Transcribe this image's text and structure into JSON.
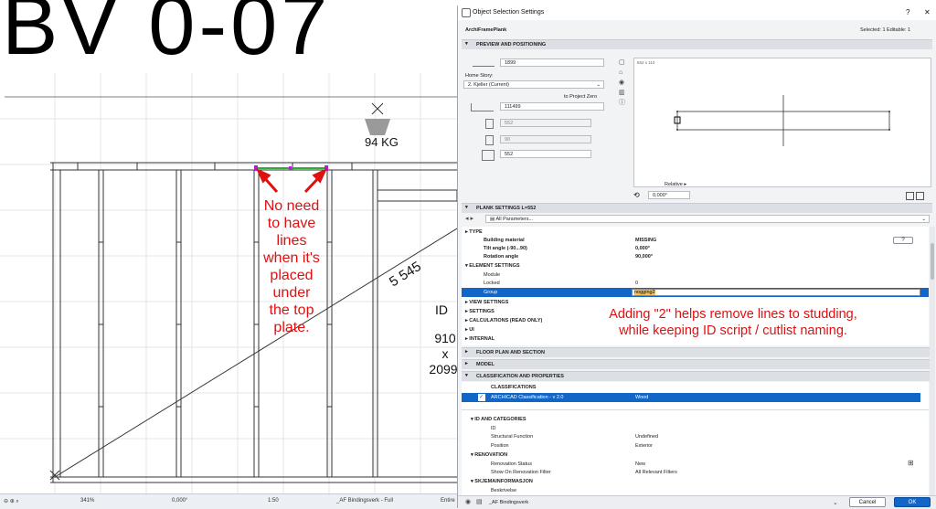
{
  "canvas": {
    "title_text": "BV 0-07",
    "weight_label": "94 KG",
    "dimension_label": "5 545",
    "id_label": "ID",
    "id_value_1": "910",
    "id_value_2": "x",
    "id_value_3": "2099",
    "annotation_left_lines": [
      "No need",
      "to have",
      "lines",
      "when it's",
      "placed",
      "under",
      "the top",
      "plate."
    ],
    "annotation_right_line1": "Adding \"2\" helps remove lines to studding,",
    "annotation_right_line2": "while keeping ID script / cutlist naming."
  },
  "statusbar": {
    "zoom": "341%",
    "angle": "0,000°",
    "scale": "1:50",
    "layer_set": "_AF Bindingsverk - Full",
    "entire": "Entire"
  },
  "dialog": {
    "title": "Object Selection Settings",
    "help": "?",
    "close": "✕",
    "object_name": "ArchiFramePlank",
    "selected_info": "Selected: 1 Editable: 1",
    "preview_section": "PREVIEW AND POSITIONING",
    "field_top": "1899",
    "home_story_label": "Home Story:",
    "home_story_value": "2. Kjeller (Current)",
    "to_project_zero": "to Project Zero",
    "elevation": "111499",
    "dim_a": "552",
    "dim_b": "90",
    "dim_c": "552",
    "preview_size": "552 x 110",
    "relative_label": "Relative",
    "angle_value": "0,000°",
    "plank_section": "PLANK SETTINGS L=552",
    "all_parameters": "All Parameters...",
    "type_heading": "TYPE",
    "params": [
      {
        "name": "Building material",
        "value": "MISSING"
      },
      {
        "name": "Tilt angle (-90...90)",
        "value": "0,000°"
      },
      {
        "name": "Rotation angle",
        "value": "90,000°"
      }
    ],
    "element_settings": "ELEMENT SETTINGS",
    "module_label": "Module",
    "locked_label": "Locked",
    "locked_value": "0",
    "group_label": "Group",
    "group_value": "nogging2",
    "view_settings": "VIEW SETTINGS",
    "settings": "SETTINGS",
    "calculations": "CALCULATIONS (READ ONLY)",
    "ui": "UI",
    "internal": "INTERNAL",
    "floor_plan_section": "FLOOR PLAN AND SECTION",
    "model_section": "MODEL",
    "classification_section": "CLASSIFICATION AND PROPERTIES",
    "classifications_heading": "CLASSIFICATIONS",
    "classification_name": "ARCHICAD Classification - v 2.0",
    "classification_value": "Wood",
    "id_categories": "ID AND CATEGORIES",
    "id_row": "ID",
    "structural_function_label": "Structural Function",
    "structural_function_value": "Undefined",
    "position_label": "Position",
    "position_value": "Exterior",
    "renovation_heading": "RENOVATION",
    "renovation_status_label": "Renovation Status",
    "renovation_status_value": "New",
    "show_on_renovation_label": "Show On Renovation Filter",
    "show_on_renovation_value": "All Relevant Filters",
    "skjema_heading": "SKJEMAINFORMASJON",
    "beskrivelse": "Beskrivelse",
    "layer_value": "_AF Bindingsverk",
    "cancel_label": "Cancel",
    "ok_label": "OK"
  },
  "colors": {
    "accent_blue": "#1266c8",
    "annotation_red": "#e01010",
    "highlight_yellow": "#f6c15a"
  }
}
